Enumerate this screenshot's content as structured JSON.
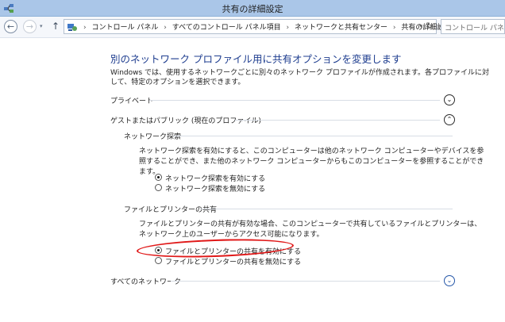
{
  "window": {
    "title": "共有の詳細設定"
  },
  "nav": {
    "back_glyph": "←",
    "forward_glyph": "→",
    "up_glyph": "↑",
    "crumbs": [
      "コントロール パネル",
      "すべてのコントロール パネル項目",
      "ネットワークと共有センター",
      "共有の詳細設定"
    ],
    "breadcrumb_separator": "›",
    "search_placeholder": "コントロール パネルの検"
  },
  "main": {
    "heading": "別のネットワーク プロファイル用に共有オプションを変更します",
    "description": "Windows では、使用するネットワークごとに別々のネットワーク プロファイルが作成されます。各プロファイルに対して、特定のオプションを選択できます。",
    "profiles": {
      "private": {
        "label": "プライベート",
        "state": "collapsed"
      },
      "guest": {
        "label": "ゲストまたはパブリック (現在のプロファイル)",
        "state": "expanded"
      },
      "all": {
        "label": "すべてのネットワーク",
        "state": "collapsed"
      }
    },
    "network_discovery": {
      "title": "ネットワーク探索",
      "text": "ネットワーク探索を有効にすると、このコンピューターは他のネットワーク コンピューターやデバイスを参照することができ、また他のネットワーク コンピューターからもこのコンピューターを参照することができます。",
      "options": [
        {
          "label": "ネットワーク探索を有効にする",
          "selected": true
        },
        {
          "label": "ネットワーク探索を無効にする",
          "selected": false
        }
      ]
    },
    "file_printer_sharing": {
      "title": "ファイルとプリンターの共有",
      "text": "ファイルとプリンターの共有が有効な場合、このコンピューターで共有しているファイルとプリンターは、ネットワーク上のユーザーからアクセス可能になります。",
      "options": [
        {
          "label": "ファイルとプリンターの共有を有効にする",
          "selected": true
        },
        {
          "label": "ファイルとプリンターの共有を無効にする",
          "selected": false
        }
      ]
    }
  },
  "icons": {
    "expand": "⌄",
    "collapse": "⌃",
    "refresh": "↻",
    "dropdown": "▾"
  },
  "colors": {
    "title_bar": "#aac6e8",
    "heading": "#1e3d8f",
    "annotation": "#e01818"
  }
}
